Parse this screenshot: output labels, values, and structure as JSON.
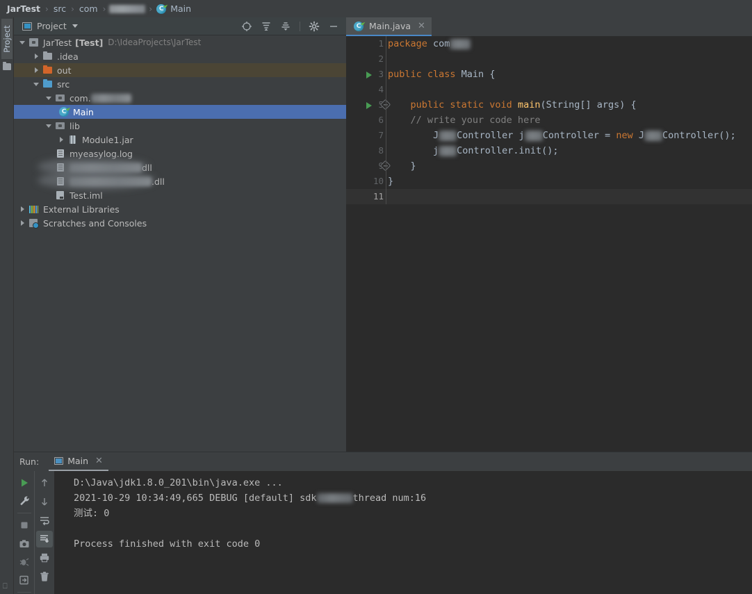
{
  "breadcrumb": {
    "items": [
      {
        "label": "JarTest",
        "bold": true,
        "type": "text"
      },
      {
        "label": "src",
        "bold": false,
        "type": "text"
      },
      {
        "label": "com",
        "bold": false,
        "type": "text"
      },
      {
        "label": "",
        "bold": false,
        "type": "blurred"
      },
      {
        "label": "Main",
        "bold": false,
        "type": "class"
      }
    ],
    "separator": "›"
  },
  "left_strip": {
    "project_tab_label": "Project",
    "folder_icon": "folder-icon"
  },
  "project_panel": {
    "title": "Project",
    "view_icon": "project-view-icon",
    "caret_icon": "chevron-down-icon",
    "tools": [
      {
        "name": "locate-icon",
        "glyph": "⊕"
      },
      {
        "name": "expand-all-icon",
        "glyph": "≡"
      },
      {
        "name": "collapse-all-icon",
        "glyph": "≡"
      },
      {
        "name": "settings-gear-icon",
        "glyph": "⚙"
      },
      {
        "name": "hide-panel-icon",
        "glyph": "—"
      }
    ],
    "tree": [
      {
        "indent": 0,
        "arrow": "down",
        "icon": "module-icon",
        "label": "JarTest",
        "bold_label": "[Test]",
        "sub": "D:\\IdeaProjects\\JarTest",
        "state": "normal"
      },
      {
        "indent": 1,
        "arrow": "right",
        "icon": "folder-gray-icon",
        "label": ".idea",
        "sub": "",
        "state": "normal"
      },
      {
        "indent": 1,
        "arrow": "right",
        "icon": "folder-orange-icon",
        "label": "out",
        "sub": "",
        "state": "excluded"
      },
      {
        "indent": 1,
        "arrow": "down",
        "icon": "folder-blue-icon",
        "label": "src",
        "sub": "",
        "state": "normal"
      },
      {
        "indent": 2,
        "arrow": "down",
        "icon": "package-icon",
        "label": "com.",
        "sub": "",
        "state": "blurred-suffix"
      },
      {
        "indent": 3,
        "arrow": "none",
        "icon": "java-class-icon",
        "label": "Main",
        "sub": "",
        "state": "selected"
      },
      {
        "indent": 2,
        "arrow": "down",
        "icon": "package-icon",
        "label": "lib",
        "sub": "",
        "state": "normal"
      },
      {
        "indent": 3,
        "arrow": "right",
        "icon": "jar-icon",
        "label": "Module1.jar",
        "sub": "",
        "state": "normal"
      },
      {
        "indent": 2,
        "arrow": "none",
        "icon": "log-file-icon",
        "label": "myeasylog.log",
        "sub": "",
        "state": "normal"
      },
      {
        "indent": 2,
        "arrow": "none",
        "icon": "dll-file-icon",
        "label": "dll",
        "sub": "",
        "state": "blurred-row"
      },
      {
        "indent": 2,
        "arrow": "none",
        "icon": "dll-file-icon",
        "label": ".dll",
        "sub": "",
        "state": "blurred-row"
      },
      {
        "indent": 2,
        "arrow": "none",
        "icon": "iml-file-icon",
        "label": "Test.iml",
        "sub": "",
        "state": "normal"
      },
      {
        "indent": 0,
        "arrow": "right",
        "icon": "external-libraries-icon",
        "label": "External Libraries",
        "sub": "",
        "state": "normal"
      },
      {
        "indent": 0,
        "arrow": "right",
        "icon": "scratches-icon",
        "label": "Scratches and Consoles",
        "sub": "",
        "state": "normal"
      }
    ]
  },
  "editor": {
    "tab": {
      "label": "Main.java",
      "icon": "java-class-icon",
      "close_icon": "close-icon"
    },
    "lines": [
      {
        "num": "1",
        "run_marker": false,
        "fold": false,
        "current": false,
        "tokens": [
          {
            "t": "kw",
            "v": "package "
          },
          {
            "t": "cls",
            "v": "com"
          },
          {
            "t": "blur",
            "v": ""
          }
        ]
      },
      {
        "num": "2",
        "run_marker": false,
        "fold": false,
        "current": false,
        "tokens": []
      },
      {
        "num": "3",
        "run_marker": true,
        "fold": false,
        "current": false,
        "tokens": [
          {
            "t": "kw",
            "v": "public class "
          },
          {
            "t": "cls",
            "v": "Main"
          },
          {
            "t": "plain",
            "v": " {"
          }
        ]
      },
      {
        "num": "4",
        "run_marker": false,
        "fold": false,
        "current": false,
        "tokens": []
      },
      {
        "num": "5",
        "run_marker": true,
        "fold": true,
        "current": false,
        "tokens": [
          {
            "t": "plain",
            "v": "    "
          },
          {
            "t": "kw",
            "v": "public static void "
          },
          {
            "t": "mth",
            "v": "main"
          },
          {
            "t": "plain",
            "v": "(String[] args) {"
          }
        ]
      },
      {
        "num": "6",
        "run_marker": false,
        "fold": false,
        "current": false,
        "tokens": [
          {
            "t": "cmt",
            "v": "    // write your code here"
          }
        ]
      },
      {
        "num": "7",
        "run_marker": false,
        "fold": false,
        "current": false,
        "tokens": [
          {
            "t": "plain",
            "v": "        J"
          },
          {
            "t": "blur",
            "v": ""
          },
          {
            "t": "plain",
            "v": "Controller j"
          },
          {
            "t": "blur",
            "v": ""
          },
          {
            "t": "plain",
            "v": "Controller = "
          },
          {
            "t": "kw",
            "v": "new "
          },
          {
            "t": "plain",
            "v": "J"
          },
          {
            "t": "blur",
            "v": ""
          },
          {
            "t": "plain",
            "v": "Controller();"
          }
        ]
      },
      {
        "num": "8",
        "run_marker": false,
        "fold": false,
        "current": false,
        "tokens": [
          {
            "t": "plain",
            "v": "        j"
          },
          {
            "t": "blur",
            "v": ""
          },
          {
            "t": "plain",
            "v": "Controller.init();"
          }
        ]
      },
      {
        "num": "9",
        "run_marker": false,
        "fold": true,
        "current": false,
        "tokens": [
          {
            "t": "plain",
            "v": "    }"
          }
        ]
      },
      {
        "num": "10",
        "run_marker": false,
        "fold": false,
        "current": false,
        "tokens": [
          {
            "t": "plain",
            "v": "}"
          }
        ]
      },
      {
        "num": "11",
        "run_marker": false,
        "fold": false,
        "current": true,
        "tokens": []
      }
    ]
  },
  "run_panel": {
    "label": "Run:",
    "tab_label": "Main",
    "tab_icon": "run-config-icon",
    "tab_close_icon": "close-icon",
    "toolbar_left": [
      {
        "name": "rerun-icon",
        "glyph": "▶",
        "selected": false,
        "color": "#499c54"
      },
      {
        "name": "edit-configuration-icon",
        "glyph": "ὒ7",
        "selected": false,
        "color": "#b0b6bb"
      },
      {
        "name": "separator",
        "glyph": "",
        "selected": false,
        "color": ""
      },
      {
        "name": "stop-icon",
        "glyph": "■",
        "selected": false,
        "color": "#8d9296"
      },
      {
        "name": "screenshot-icon",
        "glyph": "▣",
        "selected": false,
        "color": "#8d9296"
      },
      {
        "name": "debug-icon",
        "glyph": "✶",
        "selected": false,
        "color": "#73787c"
      },
      {
        "name": "export-icon",
        "glyph": "⇥",
        "selected": false,
        "color": "#8d9296"
      }
    ],
    "toolbar_right": [
      {
        "name": "up-arrow-icon",
        "glyph": "↑",
        "selected": false
      },
      {
        "name": "down-arrow-icon",
        "glyph": "↓",
        "selected": false
      },
      {
        "name": "soft-wrap-icon",
        "glyph": "↵",
        "selected": false
      },
      {
        "name": "scroll-to-end-icon",
        "glyph": "⬇",
        "selected": true
      },
      {
        "name": "print-icon",
        "glyph": "⎙",
        "selected": false
      },
      {
        "name": "clear-all-icon",
        "glyph": "Ὕ1",
        "selected": false
      }
    ],
    "console": [
      {
        "style": "cmd",
        "text": "D:\\Java\\jdk1.8.0_201\\bin\\java.exe ..."
      },
      {
        "style": "normal-blur",
        "pre": "2021-10-29 10:34:49,665 DEBUG [default] sdk",
        "post": "thread num:16"
      },
      {
        "style": "normal",
        "text": "测试: 0"
      },
      {
        "style": "normal",
        "text": ""
      },
      {
        "style": "normal",
        "text": "Process finished with exit code 0"
      }
    ]
  },
  "colors": {
    "background": "#3c3f41",
    "editor_background": "#2b2b2b",
    "selection_blue": "#4b6eaf",
    "excluded_brown": "#4b4535",
    "keyword_orange": "#cc7832",
    "method_yellow": "#ffc66d",
    "text_gray": "#a9b7c6",
    "run_green": "#499c54",
    "tab_underline": "#4a88c7"
  }
}
